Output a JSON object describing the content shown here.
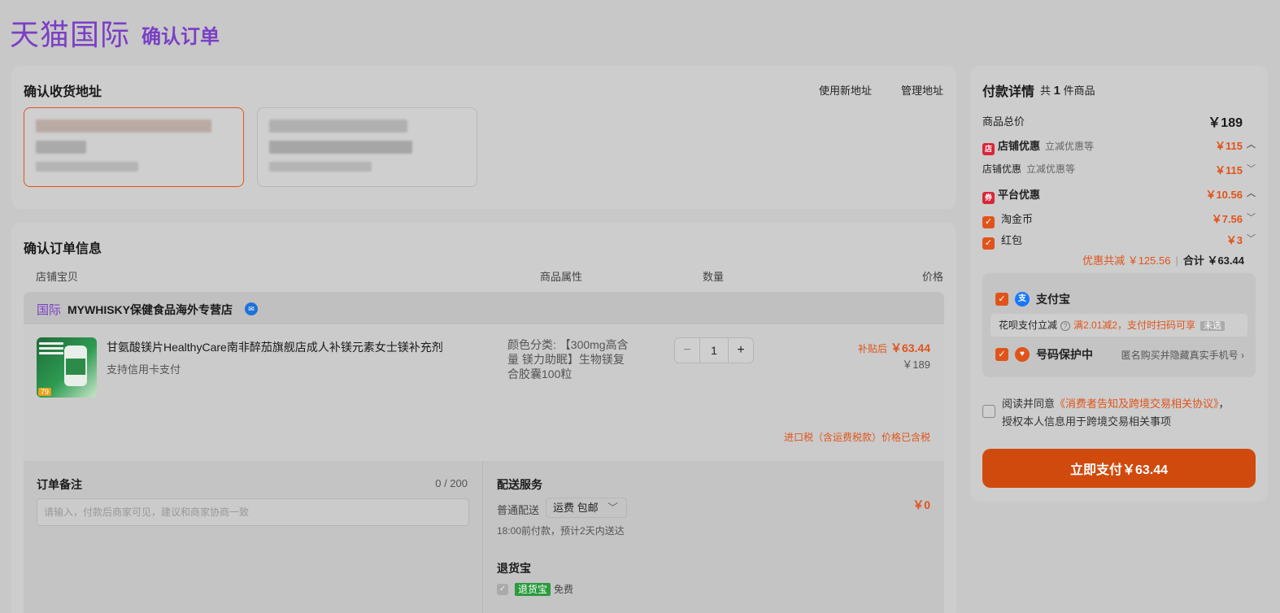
{
  "header": {
    "logo": "天猫国际",
    "title": "确认订单"
  },
  "address": {
    "title": "确认收货地址",
    "new_link": "使用新地址",
    "manage_link": "管理地址"
  },
  "order": {
    "title": "确认订单信息",
    "columns": [
      "店铺宝贝",
      "商品属性",
      "数量",
      "价格"
    ],
    "shop": {
      "tag": "国际",
      "name": "MYWHISKY保健食品海外专营店"
    },
    "item": {
      "title": "甘氨酸镁片HealthyCare南非醉茄旗舰店成人补镁元素女士镁补充剂",
      "sub": "支持信用卡支付",
      "attr": "颜色分类: 【300mg高含量 镁力助眠】生物镁复合胶囊100粒",
      "qty": "1",
      "price_label": "补贴后",
      "price_now": "￥63.44",
      "price_old": "￥189",
      "thumb_price": "79"
    },
    "tax_note": "进口税（含运费税款）价格已含税",
    "remark": {
      "title": "订单备注",
      "counter": "0 / 200",
      "placeholder": "请输入，付款后商家可见，建议和商家协商一致"
    },
    "delivery": {
      "title": "配送服务",
      "label": "普通配送",
      "option": "运费 包邮",
      "note": "18:00前付款，预计2天内送达",
      "price": "￥0"
    },
    "return": {
      "title": "退货宝",
      "tag": "退货宝",
      "free": "免费"
    }
  },
  "payment": {
    "title": "付款详情",
    "count_prefix": "共",
    "count": "1",
    "count_suffix": "件商品",
    "total_label": "商品总价",
    "total": "￥189",
    "shop_discount_label": "店铺优惠",
    "shop_discount_sub": "立减优惠等",
    "shop_discount": "￥115",
    "shop_discount2_label": "店铺优惠",
    "shop_discount2_sub": "立减优惠等",
    "shop_discount2": "￥115",
    "platform_label": "平台优惠",
    "platform": "￥10.56",
    "coin_label": "淘金币",
    "coin": "￥7.56",
    "redpack_label": "红包",
    "redpack": "￥3",
    "summary_disc": "优惠共减 ￥125.56",
    "summary_total": "合计 ￥63.44",
    "alipay": "支付宝",
    "huabei_label": "花呗支付立减",
    "huabei_promo": "满2.01减2，支付时扫码可享",
    "huabei_unsel": "未选",
    "protect_label": "号码保护中",
    "protect_desc": "匿名购买并隐藏真实手机号",
    "agree_pre": "阅读并同意",
    "agree_link": "《消费者告知及跨境交易相关协议》",
    "agree_post": "，授权本人信息用于跨境交易相关事项",
    "pay_button": "立即支付￥63.44"
  },
  "colors": {
    "brand": "#7a3fc5",
    "accent": "#e0541a",
    "pay_button": "#d04a0e"
  }
}
